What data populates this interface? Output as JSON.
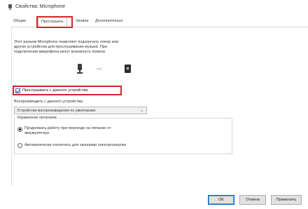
{
  "window": {
    "title": "Свойства: Microphone",
    "icon": "microphone-icon"
  },
  "tabs": [
    {
      "label": "Общие",
      "active": false
    },
    {
      "label": "Прослушать",
      "active": true
    },
    {
      "label": "Уровни",
      "active": false
    },
    {
      "label": "Дополнительно",
      "active": false
    }
  ],
  "description": [
    "Этот разъем Microphone позволяет подключать плеер или",
    "другие устройства для прослушивания музыки. При",
    "подключении микрофона могут возникнуть помехи."
  ],
  "device_icons": {
    "source": "microphone-icon",
    "arrow": "⇨",
    "target": "speaker-icon"
  },
  "listen_checkbox": {
    "label": "Прослушивать с данного устройства",
    "checked": true
  },
  "playback": {
    "label": "Воспроизводить с данного устройства:",
    "selected": "Устройство воспроизведения по умолчанию"
  },
  "power": {
    "title": "Управление питанием",
    "options": [
      {
        "lines": [
          "Продолжать работу при переходе на питание от",
          "аккумулятора"
        ],
        "selected": true
      },
      {
        "lines": [
          "Автоматически отключать для экономии электроэнергии"
        ],
        "selected": false
      }
    ]
  },
  "buttons": {
    "ok": "OK",
    "cancel": "Отмена",
    "apply": "Применить"
  },
  "colors": {
    "highlight": "#d9232b",
    "accent": "#0a64c8"
  }
}
